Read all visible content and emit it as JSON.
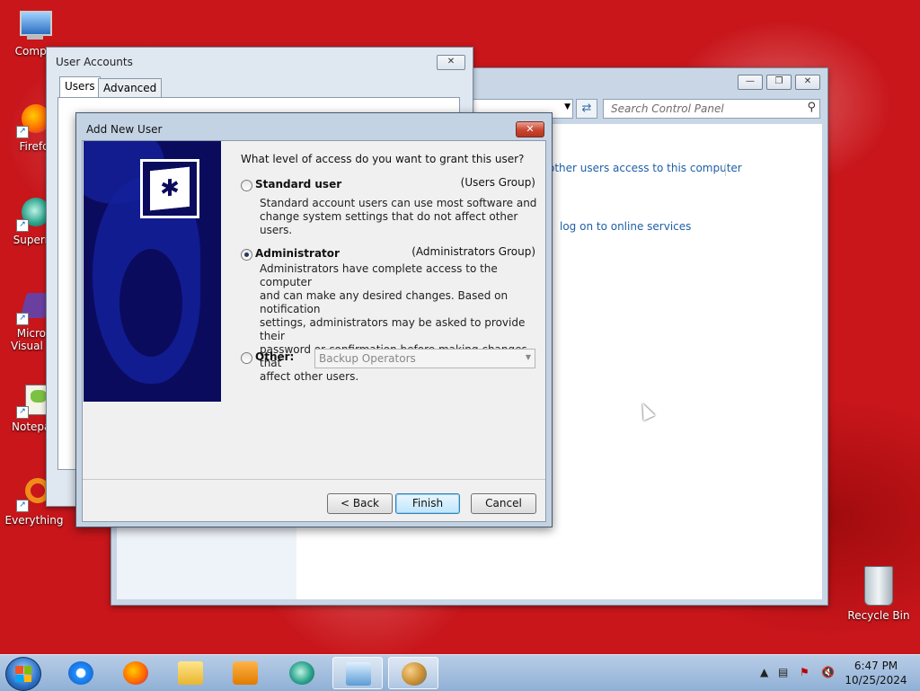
{
  "desktop": {
    "icons": [
      {
        "label": "Compu",
        "color": "#4a8fd8"
      },
      {
        "label": "Firefo",
        "color": "#e66000"
      },
      {
        "label": "Superm",
        "color": "#2ca58d"
      },
      {
        "label": "Micros",
        "label2": "Visual St",
        "color": "#6b3fa0"
      },
      {
        "label": "Notepac",
        "color": "#7cc242"
      },
      {
        "label": "Everything",
        "color": "#f08c1a"
      }
    ],
    "recycle_bin": "Recycle Bin"
  },
  "control_panel": {
    "search_placeholder": "Search Control Panel",
    "links": [
      "other users access to this computer",
      "log on to online services"
    ]
  },
  "user_accounts": {
    "title": "User Accounts",
    "tabs": [
      "Users",
      "Advanced"
    ]
  },
  "add_new_user": {
    "title": "Add New User",
    "question": "What level of access do you want to grant this user?",
    "options": {
      "standard": {
        "label": "Standard user",
        "group": "(Users Group)",
        "desc1": "Standard account users can use most software and",
        "desc2": "change system settings that do not affect other users."
      },
      "admin": {
        "label": "Administrator",
        "group": "(Administrators Group)",
        "desc1": "Administrators have complete access to the computer",
        "desc2": "and can make any desired changes. Based on notification",
        "desc3": "settings, administrators may be asked to provide their",
        "desc4": "password or confirmation before making changes that",
        "desc5": "affect other users."
      },
      "other": {
        "label": "Other:",
        "select_value": "Backup Operators"
      }
    },
    "selected": "Administrator",
    "buttons": {
      "back": "< Back",
      "finish": "Finish",
      "cancel": "Cancel"
    }
  },
  "taskbar": {
    "time": "6:47 PM",
    "date": "10/25/2024"
  }
}
